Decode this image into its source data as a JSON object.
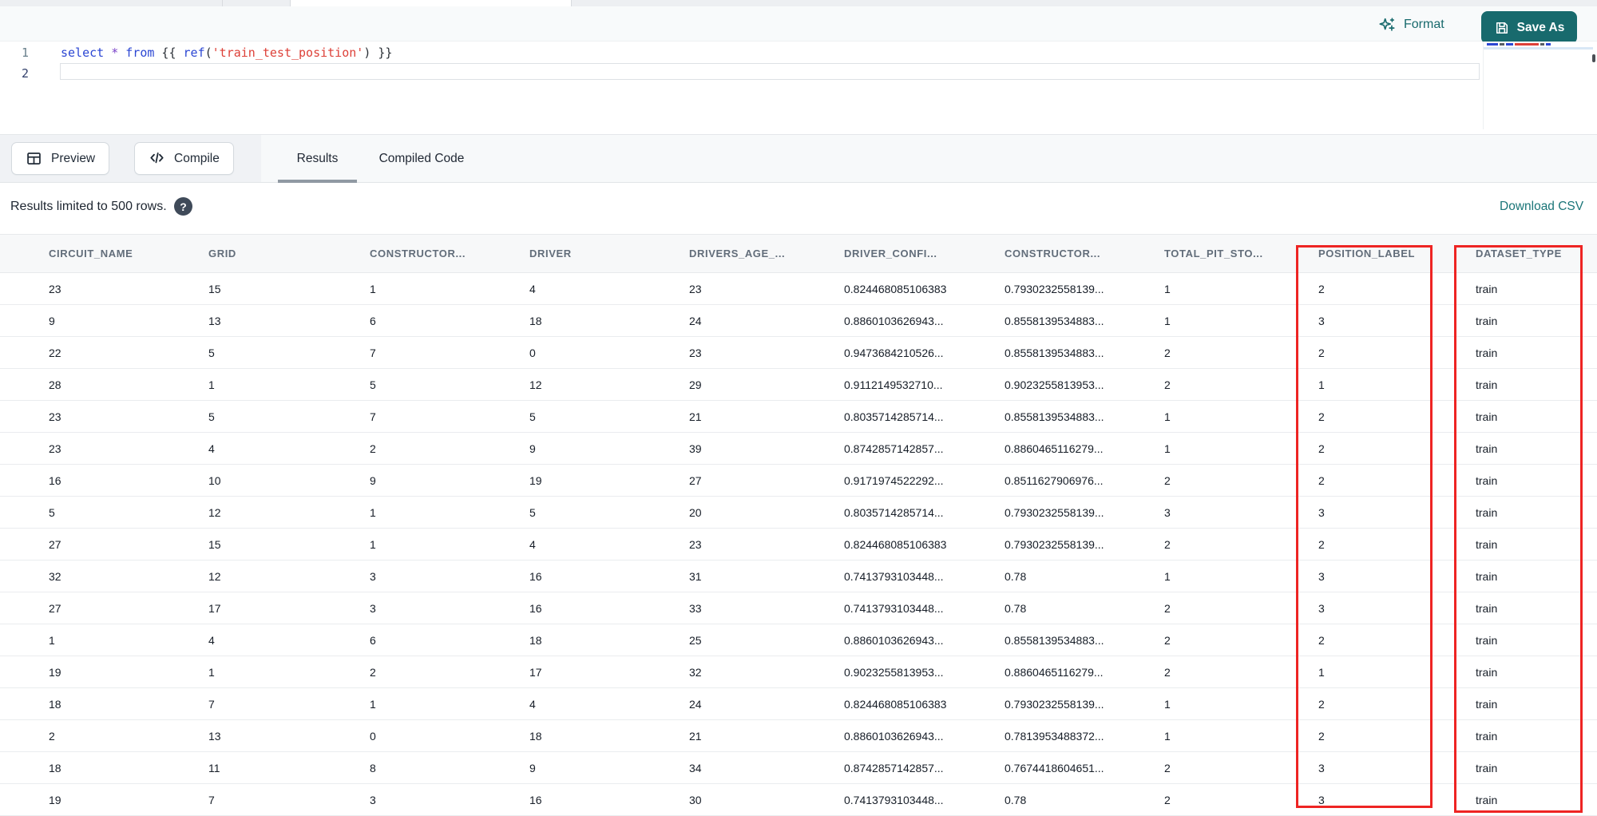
{
  "toolbar": {
    "format_label": "Format",
    "save_as_label": "Save As"
  },
  "editor": {
    "line_numbers": [
      "1",
      "2"
    ],
    "code_text": "select * from {{ ref('train_test_position') }}",
    "tokens": [
      {
        "text": "select",
        "type": "keyword"
      },
      {
        "text": " ",
        "type": "plain"
      },
      {
        "text": "*",
        "type": "operator"
      },
      {
        "text": " ",
        "type": "plain"
      },
      {
        "text": "from",
        "type": "keyword"
      },
      {
        "text": " {{ ",
        "type": "plain"
      },
      {
        "text": "ref",
        "type": "function"
      },
      {
        "text": "(",
        "type": "plain"
      },
      {
        "text": "'train_test_position'",
        "type": "string"
      },
      {
        "text": ")",
        "type": "plain"
      },
      {
        "text": " }}",
        "type": "plain"
      }
    ]
  },
  "panel": {
    "preview_label": "Preview",
    "compile_label": "Compile",
    "tabs": [
      {
        "label": "Results",
        "active": true
      },
      {
        "label": "Compiled Code",
        "active": false
      }
    ]
  },
  "results_bar": {
    "limit_note": "Results limited to 500 rows.",
    "help_glyph": "?",
    "download_label": "Download CSV"
  },
  "table": {
    "columns": [
      "CIRCUIT_NAME",
      "GRID",
      "CONSTRUCTOR...",
      "DRIVER",
      "DRIVERS_AGE_...",
      "DRIVER_CONFI...",
      "CONSTRUCTOR...",
      "TOTAL_PIT_STO...",
      "POSITION_LABEL",
      "DATASET_TYPE"
    ],
    "highlighted_columns": [
      "POSITION_LABEL",
      "DATASET_TYPE"
    ],
    "rows": [
      [
        "23",
        "15",
        "1",
        "4",
        "23",
        "0.824468085106383",
        "0.7930232558139...",
        "1",
        "2",
        "train"
      ],
      [
        "9",
        "13",
        "6",
        "18",
        "24",
        "0.8860103626943...",
        "0.8558139534883...",
        "1",
        "3",
        "train"
      ],
      [
        "22",
        "5",
        "7",
        "0",
        "23",
        "0.9473684210526...",
        "0.8558139534883...",
        "2",
        "2",
        "train"
      ],
      [
        "28",
        "1",
        "5",
        "12",
        "29",
        "0.9112149532710...",
        "0.9023255813953...",
        "2",
        "1",
        "train"
      ],
      [
        "23",
        "5",
        "7",
        "5",
        "21",
        "0.8035714285714...",
        "0.8558139534883...",
        "1",
        "2",
        "train"
      ],
      [
        "23",
        "4",
        "2",
        "9",
        "39",
        "0.8742857142857...",
        "0.8860465116279...",
        "1",
        "2",
        "train"
      ],
      [
        "16",
        "10",
        "9",
        "19",
        "27",
        "0.9171974522292...",
        "0.8511627906976...",
        "2",
        "2",
        "train"
      ],
      [
        "5",
        "12",
        "1",
        "5",
        "20",
        "0.8035714285714...",
        "0.7930232558139...",
        "3",
        "3",
        "train"
      ],
      [
        "27",
        "15",
        "1",
        "4",
        "23",
        "0.824468085106383",
        "0.7930232558139...",
        "2",
        "2",
        "train"
      ],
      [
        "32",
        "12",
        "3",
        "16",
        "31",
        "0.7413793103448...",
        "0.78",
        "1",
        "3",
        "train"
      ],
      [
        "27",
        "17",
        "3",
        "16",
        "33",
        "0.7413793103448...",
        "0.78",
        "2",
        "3",
        "train"
      ],
      [
        "1",
        "4",
        "6",
        "18",
        "25",
        "0.8860103626943...",
        "0.8558139534883...",
        "2",
        "2",
        "train"
      ],
      [
        "19",
        "1",
        "2",
        "17",
        "32",
        "0.9023255813953...",
        "0.8860465116279...",
        "2",
        "1",
        "train"
      ],
      [
        "18",
        "7",
        "1",
        "4",
        "24",
        "0.824468085106383",
        "0.7930232558139...",
        "1",
        "2",
        "train"
      ],
      [
        "2",
        "13",
        "0",
        "18",
        "21",
        "0.8860103626943...",
        "0.7813953488372...",
        "1",
        "2",
        "train"
      ],
      [
        "18",
        "11",
        "8",
        "9",
        "34",
        "0.8742857142857...",
        "0.7674418604651...",
        "2",
        "3",
        "train"
      ],
      [
        "19",
        "7",
        "3",
        "16",
        "30",
        "0.7413793103448...",
        "0.78",
        "2",
        "3",
        "train"
      ]
    ]
  },
  "colors": {
    "accent_teal": "#186a6d",
    "annotation_red": "#ee2423",
    "keyword_blue": "#2b46d3",
    "string_red": "#dd4038"
  }
}
